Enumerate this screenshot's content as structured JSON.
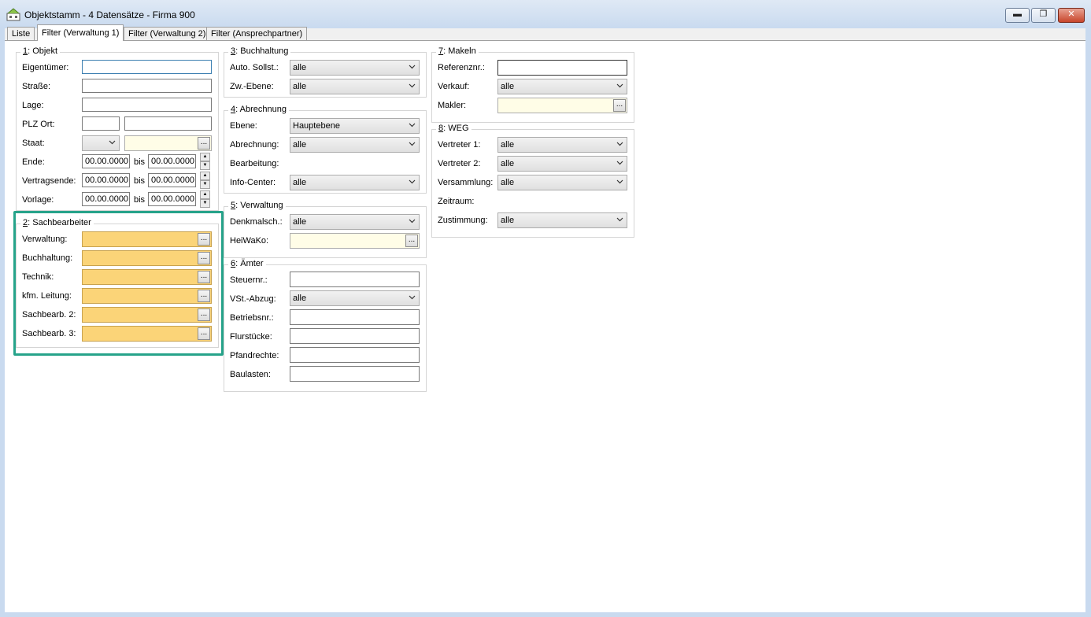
{
  "window": {
    "title": "Objektstamm - 4 Datensätze - Firma 900",
    "minimize": "▬",
    "maximize": "❐",
    "close": "✕"
  },
  "tabs": [
    "Liste",
    "Filter (Verwaltung 1)",
    "Filter (Verwaltung 2)",
    "Filter (Ansprechpartner)"
  ],
  "objekt": {
    "num": "1",
    "title": ": Objekt",
    "eigentuemer": "Eigentümer:",
    "strasse": "Straße:",
    "lage": "Lage:",
    "plz_ort": "PLZ Ort:",
    "staat": "Staat:",
    "ende": "Ende:",
    "vertragsende": "Vertragsende:",
    "vorlage": "Vorlage:",
    "bis": "bis",
    "date_value": "00.00.0000"
  },
  "sachbearbeiter": {
    "num": "2",
    "title": ": Sachbearbeiter",
    "verwaltung": "Verwaltung:",
    "buchhaltung": "Buchhaltung:",
    "technik": "Technik:",
    "kfm_leitung": "kfm. Leitung:",
    "sachbearb2": "Sachbearb. 2:",
    "sachbearb3": "Sachbearb. 3:"
  },
  "buchhaltung": {
    "num": "3",
    "title": ": Buchhaltung",
    "auto_sollst": "Auto. Sollst.:",
    "zw_ebene": "Zw.-Ebene:",
    "auto_sollst_value": "alle",
    "zw_ebene_value": "alle"
  },
  "abrechnung": {
    "num": "4",
    "title": ": Abrechnung",
    "ebene": "Ebene:",
    "ebene_value": "Hauptebene",
    "abrechnung": "Abrechnung:",
    "abrechnung_value": "alle",
    "bearbeitung": "Bearbeitung:",
    "info_center": "Info-Center:",
    "info_center_value": "alle"
  },
  "verwaltung": {
    "num": "5",
    "title": ": Verwaltung",
    "denkmalsch": "Denkmalsch.:",
    "denkmalsch_value": "alle",
    "heiwako": "HeiWaKo:"
  },
  "aemter": {
    "num": "6",
    "title": ": Ämter",
    "steuernr": "Steuernr.:",
    "vst_abzug": "VSt.-Abzug:",
    "vst_abzug_value": "alle",
    "betriebsnr": "Betriebsnr.:",
    "flurstuecke": "Flurstücke:",
    "pfandrechte": "Pfandrechte:",
    "baulasten": "Baulasten:"
  },
  "makeln": {
    "num": "7",
    "title": ": Makeln",
    "referenznr": "Referenznr.:",
    "verkauf": "Verkauf:",
    "verkauf_value": "alle",
    "makler": "Makler:"
  },
  "weg": {
    "num": "8",
    "title": ": WEG",
    "vertreter1": "Vertreter 1:",
    "vertreter1_value": "alle",
    "vertreter2": "Vertreter 2:",
    "vertreter2_value": "alle",
    "versammlung": "Versammlung:",
    "versammlung_value": "alle",
    "zeitraum": "Zeitraum:",
    "zustimmung": "Zustimmung:",
    "zustimmung_value": "alle"
  },
  "ui": {
    "dots": "...",
    "spin_up": "▲",
    "spin_down": "▼"
  },
  "colors": {
    "highlight": "#26a38a",
    "picker_orange": "#fbd478",
    "picker_yellow": "#fffde7"
  }
}
